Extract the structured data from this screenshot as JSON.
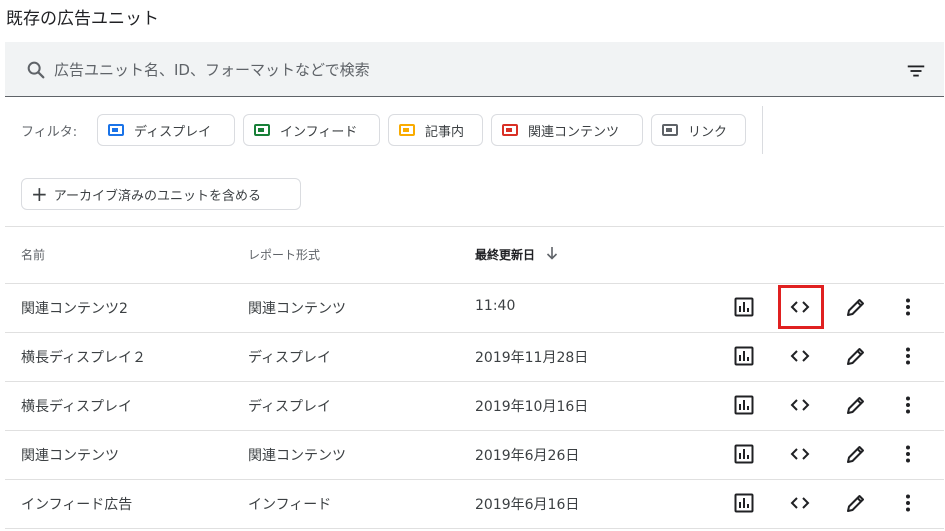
{
  "page": {
    "title": "既存の広告ユニット"
  },
  "search": {
    "placeholder": "広告ユニット名、ID、フォーマットなどで検索"
  },
  "filters": {
    "label": "フィルタ:",
    "chips": [
      {
        "label": "ディスプレイ",
        "color": "#1a73e8"
      },
      {
        "label": "インフィード",
        "color": "#188038"
      },
      {
        "label": "記事内",
        "color": "#f9ab00"
      },
      {
        "label": "関連コンテンツ",
        "color": "#d93025"
      },
      {
        "label": "リンク",
        "color": "#5f6368"
      }
    ]
  },
  "archive_button": {
    "label": "アーカイブ済みのユニットを含める"
  },
  "table": {
    "headers": {
      "name": "名前",
      "report_format": "レポート形式",
      "last_updated": "最終更新日"
    },
    "rows": [
      {
        "name": "関連コンテンツ2",
        "format": "関連コンテンツ",
        "updated": "11:40"
      },
      {
        "name": "横長ディスプレイ２",
        "format": "ディスプレイ",
        "updated": "2019年11月28日"
      },
      {
        "name": "横長ディスプレイ",
        "format": "ディスプレイ",
        "updated": "2019年10月16日"
      },
      {
        "name": "関連コンテンツ",
        "format": "関連コンテンツ",
        "updated": "2019年6月26日"
      },
      {
        "name": "インフィード広告",
        "format": "インフィード",
        "updated": "2019年6月16日"
      }
    ]
  },
  "colors": {
    "highlight": "#e02020"
  },
  "icons": [
    "search-icon",
    "filter-list-icon",
    "arrow-down-icon",
    "bar-chart-icon",
    "code-icon",
    "pencil-icon",
    "more-vert-icon"
  ]
}
